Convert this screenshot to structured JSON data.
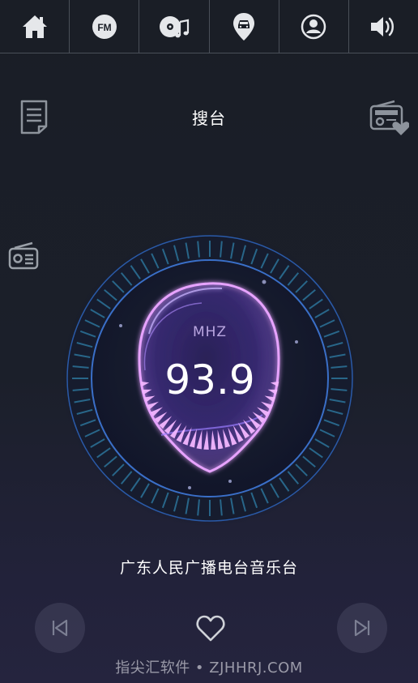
{
  "topbar": {
    "items": [
      {
        "icon": "home-icon"
      },
      {
        "icon": "fm-icon",
        "label": "FM"
      },
      {
        "icon": "music-disc-icon"
      },
      {
        "icon": "car-location-icon"
      },
      {
        "icon": "user-icon"
      },
      {
        "icon": "volume-icon"
      }
    ]
  },
  "header": {
    "title": "搜台"
  },
  "radio": {
    "unit": "MHZ",
    "frequency": "93.9",
    "station_name": "广东人民广播电台音乐台"
  },
  "watermark": {
    "text": "指尖汇软件 • ZJHHRJ.COM"
  },
  "colors": {
    "accent": "#b98bff",
    "glow": "#f4a6ff",
    "icon": "#d8dbe0",
    "ring": "#1f3f7a"
  }
}
